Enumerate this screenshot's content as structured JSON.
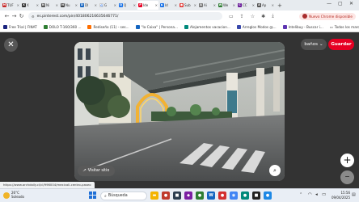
{
  "tabs": [
    {
      "label": "TUF",
      "color": "#c62828",
      "glyph": "M",
      "active": false
    },
    {
      "label": "X",
      "color": "#333333",
      "glyph": "X",
      "active": false
    },
    {
      "label": "Ni",
      "color": "#555555",
      "glyph": "N",
      "active": false
    },
    {
      "label": "Nu",
      "color": "#444444",
      "glyph": "N",
      "active": false
    },
    {
      "label": "Dl",
      "color": "#1565c0",
      "glyph": "D",
      "active": false
    },
    {
      "label": "G",
      "color": "#ffffff",
      "glyph": "G",
      "active": false
    },
    {
      "label": "Q",
      "color": "#1a73e8",
      "glyph": "Q",
      "active": false
    },
    {
      "label": "Ide",
      "color": "#e60023",
      "glyph": "P",
      "active": true
    },
    {
      "label": "Id",
      "color": "#1a73e8",
      "glyph": "▶",
      "active": false
    },
    {
      "label": "Sub",
      "color": "#e53935",
      "glyph": "●",
      "active": false
    },
    {
      "label": "Ai",
      "color": "#777777",
      "glyph": "A",
      "active": false
    },
    {
      "label": "We",
      "color": "#2e7d32",
      "glyph": "W",
      "active": false
    },
    {
      "label": "CC",
      "color": "#6a1b9a",
      "glyph": "C",
      "active": false
    },
    {
      "label": "Ap",
      "color": "#555555",
      "glyph": "A",
      "active": false
    }
  ],
  "window": {
    "minimize": "—",
    "maximize": "▢",
    "close": "✕"
  },
  "address_bar": {
    "url": "es.pinterest.com/pin/401806216635646771/",
    "back": "←",
    "forward": "→",
    "reload": "↻"
  },
  "chrome_update": {
    "label": "Nuevo Chrome disponible"
  },
  "bookmarks": [
    {
      "label": "Free Trial | FINAT",
      "color": "#1a237e"
    },
    {
      "label": "DOLO T-160/360 ...",
      "color": "#2e7d32"
    },
    {
      "label": "Rediseño (11) - ses...",
      "color": "#ff6f00"
    },
    {
      "label": "\"la Caixa\" | Persona...",
      "color": "#1565c0"
    },
    {
      "label": "Alojamentos vacacion...",
      "color": "#00897b"
    },
    {
      "label": "Arreglos Modos @...",
      "color": "#3949ab"
    },
    {
      "label": "Intelibuy - Buscar i...",
      "color": "#5e35b1"
    }
  ],
  "bookmarks_all": "Todos los marcadores",
  "pin": {
    "board_label": "baños",
    "save_label": "Guardar",
    "visit_label": "Visitar sitio",
    "close_symbol": "✕",
    "zoom_in": "+",
    "zoom_out": "–"
  },
  "status_url": "https://www.archdaily.cl/cl/996004/mexicali-centro-paseo",
  "taskbar": {
    "weather_temp": "26°C",
    "weather_desc": "Soleado",
    "search_placeholder": "Búsqueda",
    "time": "15:56",
    "date": "09/04/2025",
    "apps": [
      {
        "name": "file-explorer",
        "color": "#f4b400",
        "glyph": "▬"
      },
      {
        "name": "app-1",
        "color": "#c0392b",
        "glyph": "●"
      },
      {
        "name": "app-2",
        "color": "#2c3e50",
        "glyph": "■"
      },
      {
        "name": "app-3",
        "color": "#7b1fa2",
        "glyph": "◆"
      },
      {
        "name": "app-4",
        "color": "#2e7d32",
        "glyph": "●"
      },
      {
        "name": "app-5",
        "color": "#1565c0",
        "glyph": "W"
      },
      {
        "name": "app-6",
        "color": "#d32f2f",
        "glyph": "●"
      },
      {
        "name": "chrome",
        "color": "#4285f4",
        "glyph": "◉"
      },
      {
        "name": "app-8",
        "color": "#00897b",
        "glyph": "●"
      },
      {
        "name": "app-9",
        "color": "#212121",
        "glyph": "■"
      },
      {
        "name": "app-10",
        "color": "#1e88e5",
        "glyph": "●"
      }
    ]
  }
}
